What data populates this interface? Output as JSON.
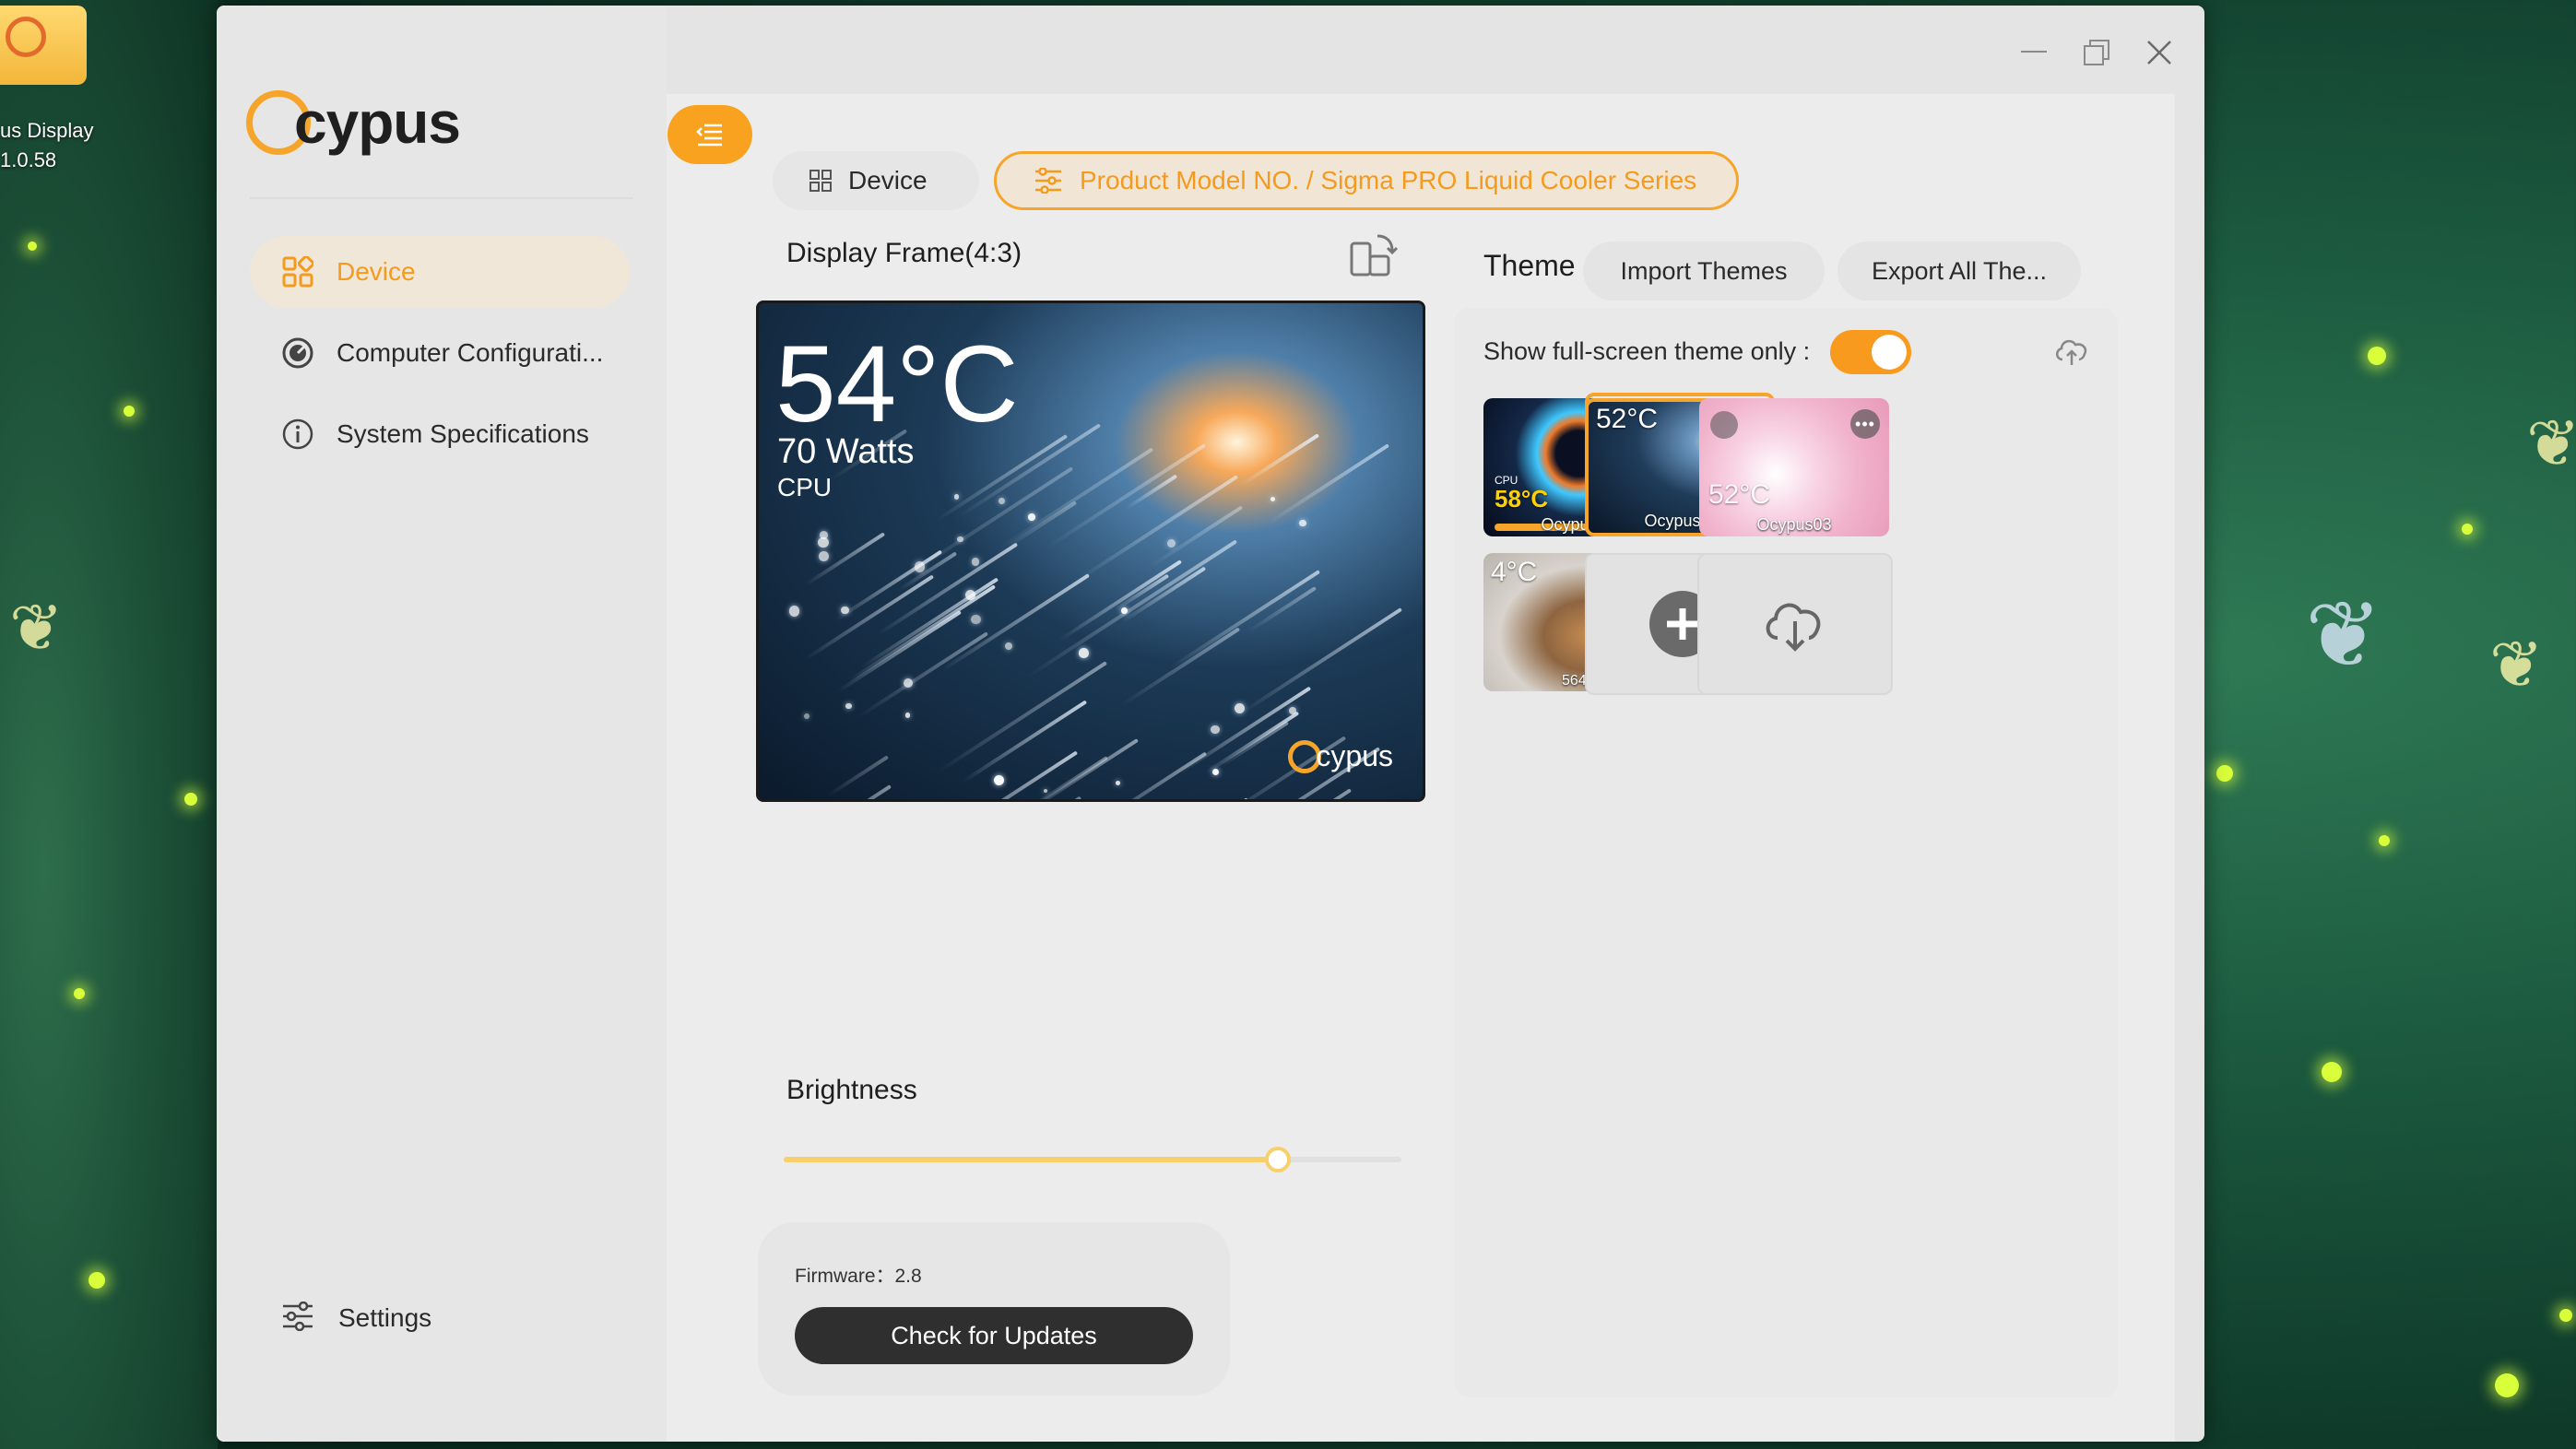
{
  "desktop": {
    "icon_label_line1": "us Display",
    "icon_label_line2": "1.0.58"
  },
  "window": {
    "minimize_icon": "minimize-icon",
    "maximize_icon": "maximize-icon",
    "close_icon": "close-icon"
  },
  "sidebar": {
    "logo_text": "cypus",
    "items": [
      {
        "label": "Device",
        "icon": "device-grid-icon",
        "active": true
      },
      {
        "label": "Computer Configurati...",
        "icon": "gauge-icon",
        "active": false
      },
      {
        "label": "System Specifications",
        "icon": "info-icon",
        "active": false
      }
    ],
    "settings_label": "Settings"
  },
  "tabs": {
    "device_label": "Device",
    "model_label": "Product Model NO. / Sigma PRO Liquid Cooler Series"
  },
  "display": {
    "title": "Display Frame(4:3)",
    "preview_temp": "54°C",
    "preview_watts": "70 Watts",
    "preview_cpu": "CPU",
    "preview_logo": "cypus"
  },
  "brightness": {
    "label": "Brightness",
    "value_fraction": 0.8
  },
  "firmware": {
    "text": "Firmware：2.8",
    "update_button": "Check for Updates"
  },
  "theme": {
    "label": "Theme",
    "import_button": "Import Themes",
    "export_button": "Export All The...",
    "fullscreen_label": "Show full-screen theme only :",
    "fullscreen_on": true,
    "thumbnails": [
      {
        "name": "Ocypus01",
        "temp": "58°C",
        "sub": "CPU"
      },
      {
        "name": "Ocypus02",
        "temp": "52°C",
        "selected": true
      },
      {
        "name": "Ocypus03",
        "temp": "52°C"
      },
      {
        "name": "",
        "temp": "4°C",
        "sub": "564+"
      }
    ]
  },
  "colors": {
    "accent": "#f7a52a",
    "accent_bg": "#f1e6d6",
    "dark_button": "#2f2f2f"
  }
}
